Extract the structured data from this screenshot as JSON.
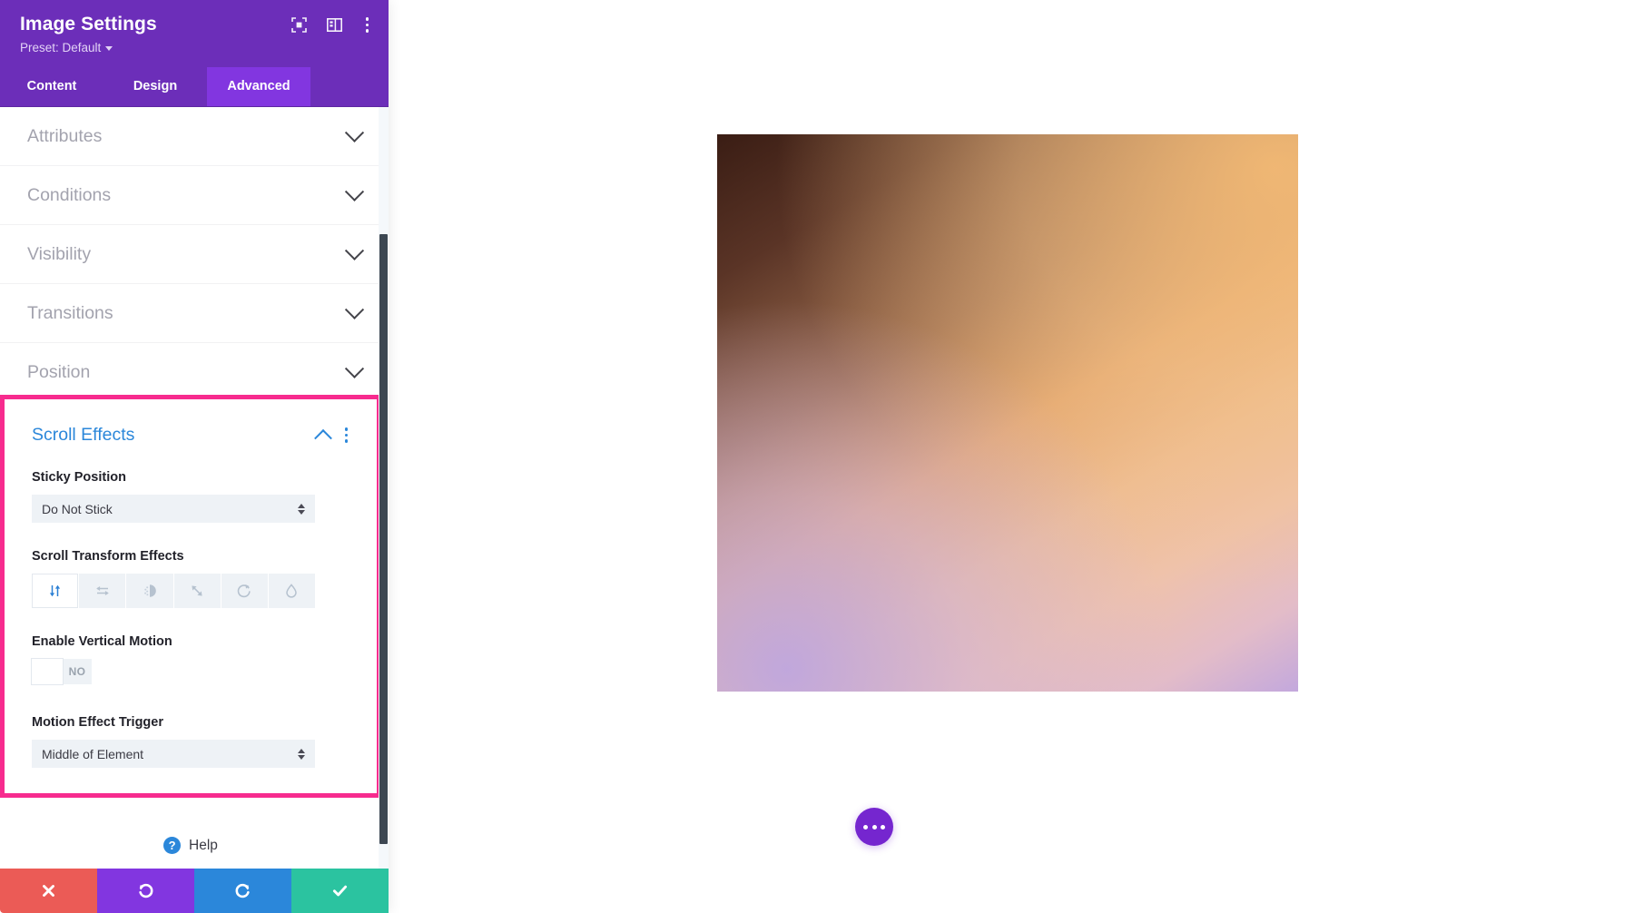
{
  "panel": {
    "title": "Image Settings",
    "preset_label": "Preset: Default",
    "header_icons": [
      {
        "name": "focus-frame-icon",
        "glyph": "focus"
      },
      {
        "name": "layout-panel-icon",
        "glyph": "panel"
      },
      {
        "name": "more-vertical-icon",
        "glyph": "dots"
      }
    ],
    "tabs": [
      {
        "label": "Content",
        "active": false
      },
      {
        "label": "Design",
        "active": false
      },
      {
        "label": "Advanced",
        "active": true
      }
    ],
    "sections": [
      {
        "label": "Attributes",
        "expanded": false
      },
      {
        "label": "Conditions",
        "expanded": false
      },
      {
        "label": "Visibility",
        "expanded": false
      },
      {
        "label": "Transitions",
        "expanded": false
      },
      {
        "label": "Position",
        "expanded": false
      }
    ],
    "scroll_effects": {
      "title": "Scroll Effects",
      "expanded": true,
      "highlight_color": "#f72b8e",
      "title_color": "#2b87da",
      "sticky_position": {
        "label": "Sticky Position",
        "value": "Do Not Stick"
      },
      "scroll_transform_effects": {
        "label": "Scroll Transform Effects",
        "options": [
          {
            "name": "vertical-motion-icon",
            "selected": true
          },
          {
            "name": "horizontal-motion-icon",
            "selected": false
          },
          {
            "name": "fading-in-out-icon",
            "selected": false
          },
          {
            "name": "scaling-up-down-icon",
            "selected": false
          },
          {
            "name": "rotating-icon",
            "selected": false
          },
          {
            "name": "blur-icon",
            "selected": false
          }
        ]
      },
      "enable_vertical_motion": {
        "label": "Enable Vertical Motion",
        "value": "NO",
        "on": false
      },
      "motion_effect_trigger": {
        "label": "Motion Effect Trigger",
        "value": "Middle of Element"
      }
    },
    "help": {
      "label": "Help",
      "badge": "?"
    },
    "footer_buttons": [
      {
        "name": "cancel-button",
        "glyph": "✕",
        "color": "#eb5b56"
      },
      {
        "name": "undo-button",
        "glyph": "↺",
        "color": "#8236e0"
      },
      {
        "name": "redo-button",
        "glyph": "↻",
        "color": "#2b87da"
      },
      {
        "name": "save-button",
        "glyph": "✔",
        "color": "#2bc3a0"
      }
    ]
  },
  "canvas": {
    "image_alt": "gradient-image",
    "fab_label": "more-options"
  }
}
